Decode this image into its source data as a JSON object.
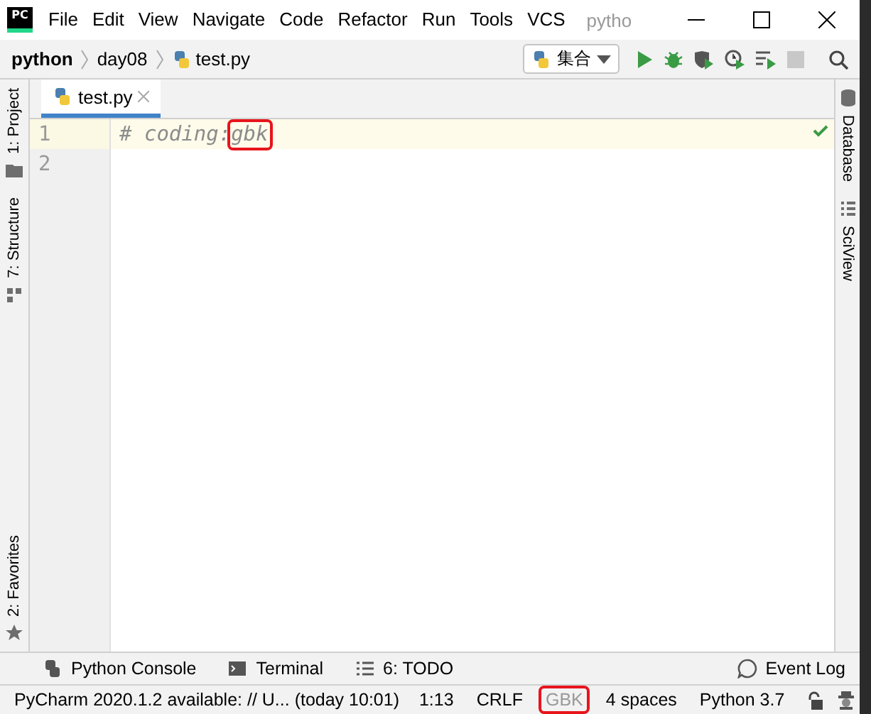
{
  "logo": "PC",
  "menu": [
    "File",
    "Edit",
    "View",
    "Navigate",
    "Code",
    "Refactor",
    "Run",
    "Tools",
    "VCS"
  ],
  "window": {
    "title": "pytho"
  },
  "breadcrumbs": [
    "python",
    "day08",
    "test.py"
  ],
  "run_config": "集合",
  "tabs": [
    {
      "label": "test.py",
      "selected": true
    }
  ],
  "left_stripe": [
    {
      "label": "1: Project",
      "kind": "folder"
    },
    {
      "label": "7: Structure",
      "kind": "structure"
    },
    {
      "label": "2: Favorites",
      "kind": "star"
    }
  ],
  "right_stripe": [
    {
      "label": "Database",
      "kind": "database"
    },
    {
      "label": "SciView",
      "kind": "grid"
    }
  ],
  "editor": {
    "lines": [
      {
        "number": "1",
        "current": true,
        "tokens": [
          {
            "text": "# coding:",
            "highlighted": false
          },
          {
            "text": "gbk",
            "highlighted": true
          }
        ]
      },
      {
        "number": "2",
        "current": false
      }
    ]
  },
  "tool_windows": [
    {
      "label": "Python Console",
      "kind": "python"
    },
    {
      "label": "Terminal",
      "kind": "terminal"
    },
    {
      "label": "6: TODO",
      "kind": "todo"
    }
  ],
  "event_log": "Event Log",
  "status_bar": {
    "message": "PyCharm 2020.1.2 available: // U... (today 10:01)",
    "items": [
      {
        "text": "1:13",
        "highlighted": false
      },
      {
        "text": "CRLF",
        "highlighted": false
      },
      {
        "text": "GBK",
        "highlighted": true
      },
      {
        "text": "4 spaces",
        "highlighted": false
      },
      {
        "text": "Python 3.7",
        "highlighted": false
      }
    ]
  }
}
